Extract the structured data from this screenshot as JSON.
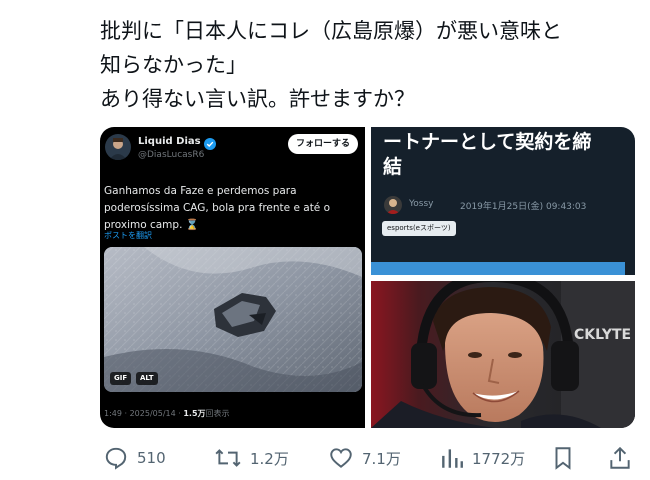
{
  "tweet": {
    "lines": [
      "批判に「日本人にコレ（広島原爆）が悪い意味と",
      "知らなかった」",
      "あり得ない言い訳。許せますか？"
    ]
  },
  "embedded_post": {
    "display_name": "Liquid Dias",
    "handle": "@DiasLucasR6",
    "follow_label": "フォローする",
    "text": "Ganhamos da Faze e perdemos para poderosíssima CAG, bola pra frente e até o proximo camp. ⌛",
    "translate_label": "ポストを翻訳",
    "badges": [
      "GIF",
      "ALT"
    ],
    "meta_time": "1:49 · 2025/05/14 · ",
    "meta_views": "1.5万",
    "meta_views_suffix": "回表示"
  },
  "article": {
    "title_lines": [
      "ートナーとして契約を締",
      "結"
    ],
    "author": "Yossy",
    "date": "2019年1月25日(金) 09:43:03",
    "tag": "esports(eスポーツ)"
  },
  "photo": {
    "headset_text": "CKLYTE"
  },
  "actions": {
    "reply_count": "510",
    "retweet_count": "1.2万",
    "like_count": "7.1万",
    "view_count": "1772万",
    "icons": [
      "reply-icon",
      "retweet-icon",
      "like-icon",
      "views-icon",
      "bookmark-icon",
      "share-icon"
    ]
  },
  "colors": {
    "text": "#0f1419",
    "secondary": "#536471",
    "link_blue": "#1d9bf0",
    "embedded_bg": "#000000",
    "article_bg": "#15202b"
  }
}
